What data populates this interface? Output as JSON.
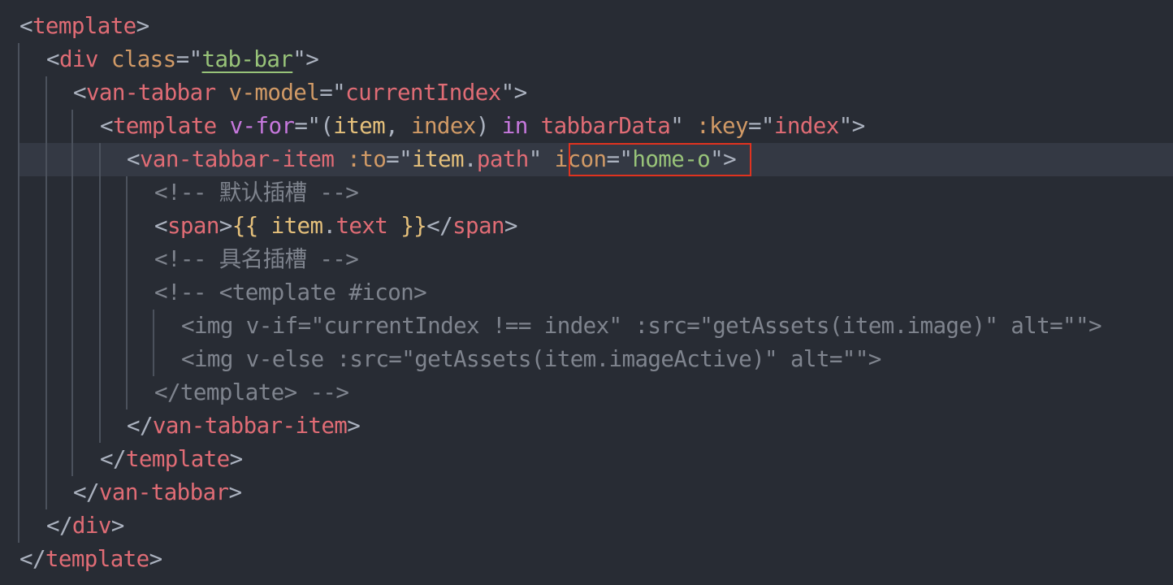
{
  "code": {
    "template_open": "template",
    "div_tag": "div",
    "class_attr": "class",
    "class_value": "tab-bar",
    "van_tabbar": "van-tabbar",
    "vmodel_attr": "v-model",
    "vmodel_value": "currentIndex",
    "template_tag": "template",
    "vfor_attr": "v-for",
    "vfor_item": "item",
    "vfor_index": "index",
    "vfor_in": "in",
    "vfor_source": "tabbarData",
    "key_attr": ":key",
    "key_value": "index",
    "tabbar_item": "van-tabbar-item",
    "to_attr": ":to",
    "to_obj": "item",
    "to_prop": "path",
    "icon_attr": "icon",
    "icon_value": "home-o",
    "comment_default_slot": "<!-- 默认插槽 -->",
    "span_tag": "span",
    "mustache_open": "{{ ",
    "mustache_obj": "item",
    "mustache_prop": "text",
    "mustache_close": " }}",
    "comment_named_slot": "<!-- 具名插槽 -->",
    "comment_template_icon": "<!-- <template #icon>",
    "comment_img1": "<img v-if=\"currentIndex !== index\" :src=\"getAssets(item.image)\" alt=\"\">",
    "comment_img2": "<img v-else :src=\"getAssets(item.imageActive)\" alt=\"\">",
    "comment_template_close": "</template> -->"
  }
}
